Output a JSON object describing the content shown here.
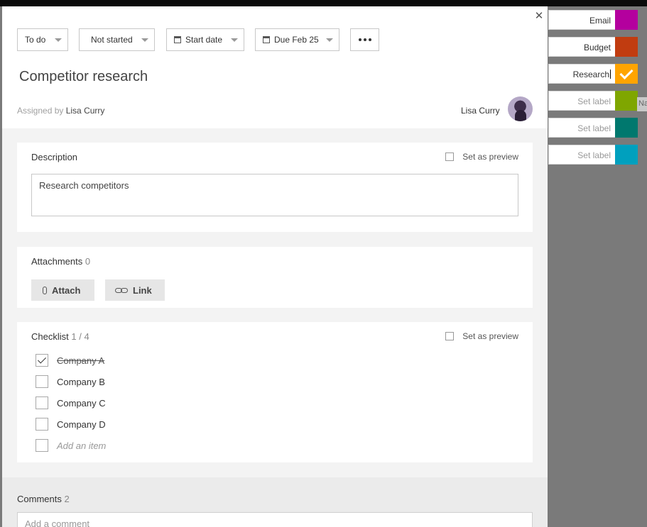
{
  "toolbar": {
    "bucket": "To do",
    "progress": "Not started",
    "start_date": "Start date",
    "due_date": "Due Feb 25"
  },
  "task": {
    "title": "Competitor research",
    "assigned_prefix": "Assigned by",
    "assigned_by": "Lisa Curry",
    "assignee": "Lisa Curry"
  },
  "description": {
    "heading": "Description",
    "preview_label": "Set as preview",
    "text": "Research competitors"
  },
  "attachments": {
    "heading": "Attachments",
    "count": "0",
    "attach_label": "Attach",
    "link_label": "Link"
  },
  "checklist": {
    "heading": "Checklist",
    "progress": "1 / 4",
    "preview_label": "Set as preview",
    "items": [
      {
        "text": "Company A",
        "done": true
      },
      {
        "text": "Company B",
        "done": false
      },
      {
        "text": "Company C",
        "done": false
      },
      {
        "text": "Company D",
        "done": false
      }
    ],
    "add_placeholder": "Add an item"
  },
  "comments": {
    "heading": "Comments",
    "count": "2",
    "placeholder": "Add a comment"
  },
  "labels": [
    {
      "name": "Email",
      "color": "#b4009e",
      "checked": false
    },
    {
      "name": "Budget",
      "color": "#c13c10",
      "checked": false
    },
    {
      "name": "Research",
      "color": "#ffa400",
      "checked": true
    },
    {
      "name": "Set label",
      "color": "#7fa600",
      "checked": false
    },
    {
      "name": "Set label",
      "color": "#00786e",
      "checked": false
    },
    {
      "name": "Set label",
      "color": "#00a0be",
      "checked": false
    }
  ],
  "tooltip_fragment": "Na"
}
